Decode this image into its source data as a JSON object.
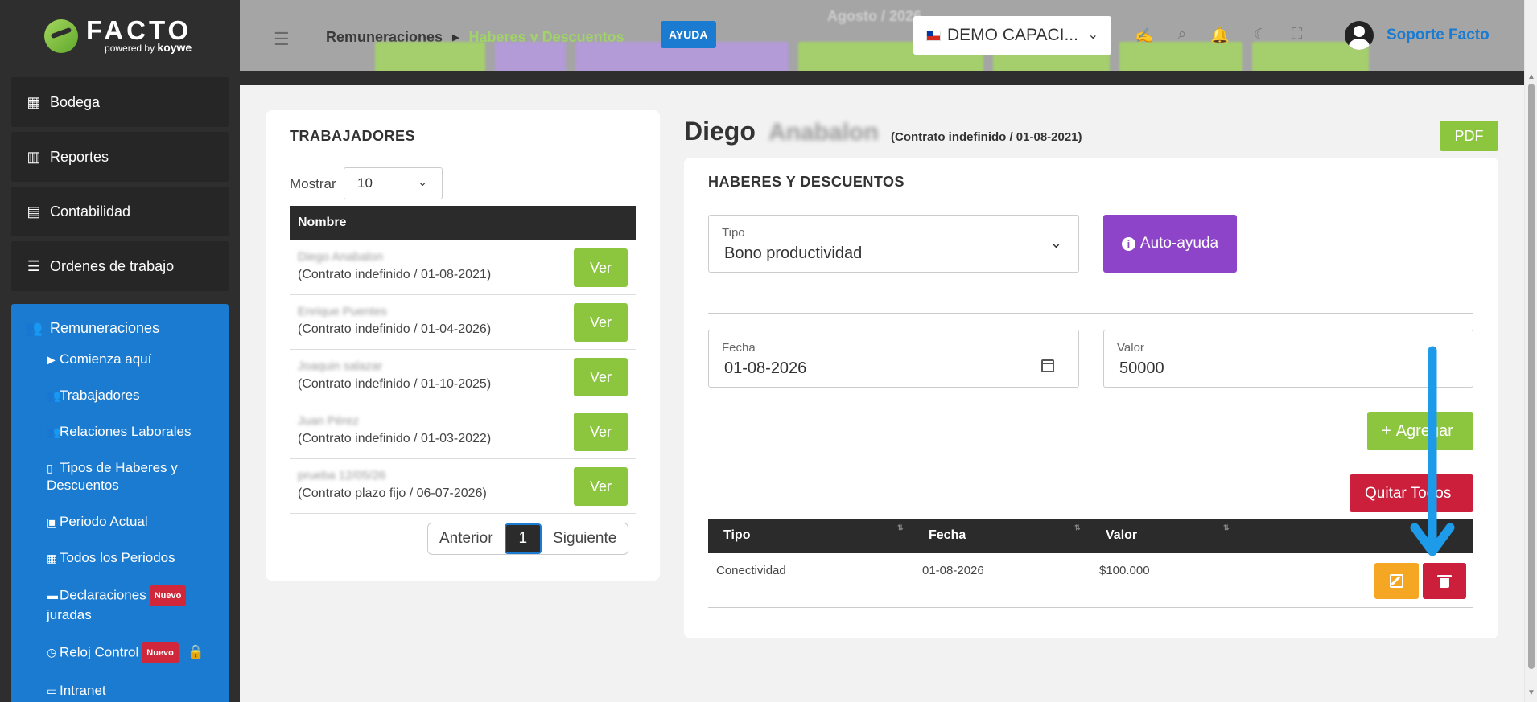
{
  "sidebar": {
    "logo": {
      "brand": "FACTO",
      "powered": "powered",
      "by": "by",
      "sub_brand": "koywe"
    },
    "blocks": [
      {
        "label": "Bodega",
        "icon": "boxes-icon"
      },
      {
        "label": "Reportes",
        "icon": "bar-chart-icon"
      },
      {
        "label": "Contabilidad",
        "icon": "calculator-icon"
      },
      {
        "label": "Ordenes de trabajo",
        "icon": "checklist-icon"
      }
    ],
    "active_section": {
      "label": "Remuneraciones",
      "icon": "users-icon"
    },
    "sub_items": [
      {
        "label": "Comienza aquí",
        "icon": "play-icon"
      },
      {
        "label": "Trabajadores",
        "icon": "users-cog-icon"
      },
      {
        "label": "Relaciones Laborales",
        "icon": "users-icon"
      },
      {
        "label": "Tipos de Haberes y",
        "label2": "Descuentos",
        "icon": "file-icon"
      },
      {
        "label": "Periodo Actual",
        "icon": "calendar-icon"
      },
      {
        "label": "Todos los Periodos",
        "icon": "calendar-grid-icon"
      },
      {
        "label": "Declaraciones",
        "label2": "juradas",
        "badge": "Nuevo",
        "icon": "archive-icon"
      },
      {
        "label": "Reloj Control",
        "badge": "Nuevo",
        "icon": "clock-icon",
        "lock_icon": "lock-icon"
      },
      {
        "label": "Intranet",
        "icon": "monitor-icon"
      }
    ]
  },
  "header": {
    "breadcrumb": {
      "parent": "Remuneraciones",
      "current": "Haberes y Descuentos"
    },
    "help_label": "AYUDA",
    "ghost_title": "Agosto / 2026",
    "company": "DEMO CAPACI...",
    "user_name": "Soporte Facto",
    "icons": [
      "signature-icon",
      "search-icon",
      "bell-icon",
      "moon-icon",
      "fullscreen-icon"
    ]
  },
  "workers": {
    "title": "TRABAJADORES",
    "show_label": "Mostrar",
    "page_size": "10",
    "column": "Nombre",
    "button_label": "Ver",
    "rows": [
      {
        "name": "Diego Anabalon",
        "contract": "(Contrato indefinido / 01-08-2021)"
      },
      {
        "name": "Enrique Puentes",
        "contract": "(Contrato indefinido / 01-04-2026)"
      },
      {
        "name": "Joaquin salazar",
        "contract": "(Contrato indefinido / 01-10-2025)"
      },
      {
        "name": "Juan Pérez",
        "contract": "(Contrato indefinido / 01-03-2022)"
      },
      {
        "name": "prueba 12/05/26",
        "contract": "(Contrato plazo fijo / 06-07-2026)"
      }
    ],
    "pager": {
      "prev": "Anterior",
      "page": "1",
      "next": "Siguiente"
    }
  },
  "employee": {
    "first_name": "Diego",
    "surname": "Anabalon",
    "contract": "(Contrato indefinido / 01-08-2021)",
    "pdf_label": "PDF"
  },
  "form": {
    "title": "HABERES Y DESCUENTOS",
    "tipo_label": "Tipo",
    "tipo_value": "Bono productividad",
    "help_button": "Auto-ayuda",
    "fecha_label": "Fecha",
    "fecha_value": "01-08-2026",
    "valor_label": "Valor",
    "valor_value": "50000",
    "add_button": "Agregar",
    "clear_button": "Quitar Todos"
  },
  "entries": {
    "columns": [
      "Tipo",
      "Fecha",
      "Valor"
    ],
    "rows": [
      {
        "tipo": "Conectividad",
        "fecha": "01-08-2026",
        "valor": "$100.000"
      }
    ]
  },
  "colors": {
    "accent_blue": "#1a7bd0",
    "green": "#8cc63f",
    "purple": "#8e44c8",
    "red": "#cc1f3c",
    "orange": "#f5a623",
    "annotation_arrow": "#1e9be8"
  }
}
